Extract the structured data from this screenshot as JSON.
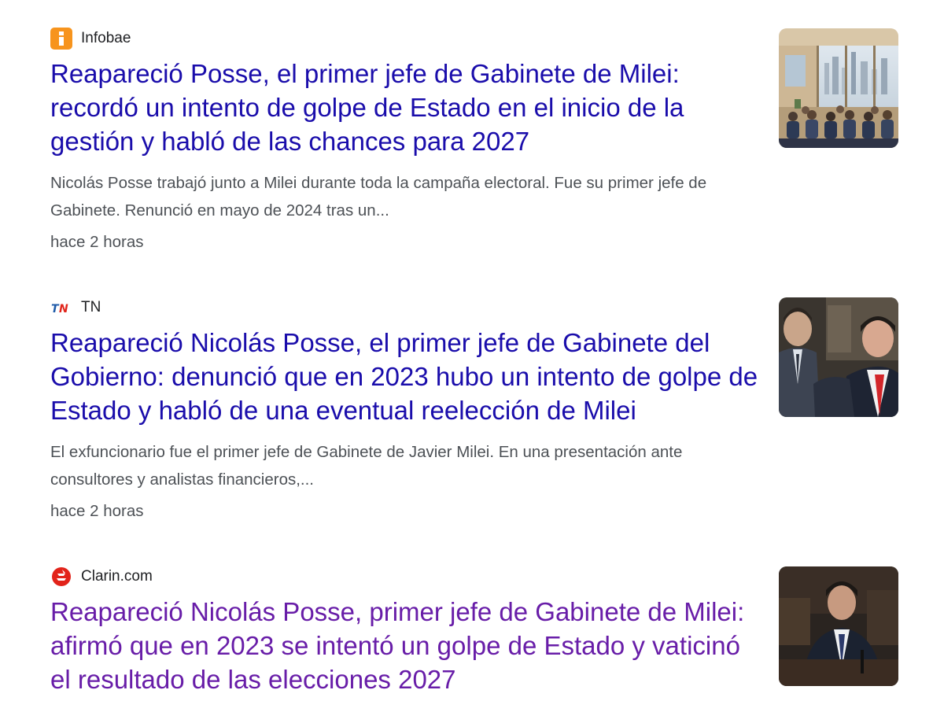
{
  "results": [
    {
      "source": "Infobae",
      "source_icon": "infobae-logo",
      "headline": "Reapareció Posse, el primer jefe de Gabinete de Milei: recordó un intento de golpe de Estado en el inicio de la gestión y habló de las chances para 2027",
      "snippet": "Nicolás Posse trabajó junto a Milei durante toda la campaña electoral. Fue su primer jefe de Gabinete. Renunció en mayo de 2024 tras un...",
      "time": "hace 2 horas",
      "thumbnail": "conference-room-illustration",
      "visited": false
    },
    {
      "source": "TN",
      "source_icon": "tn-logo",
      "headline": "Reapareció Nicolás Posse, el primer jefe de Gabinete del Gobierno: denunció que en 2023 hubo un intento de golpe de Estado y habló de una eventual reelección de Milei",
      "snippet": "El exfuncionario fue el primer jefe de Gabinete de Javier Milei. En una presentación ante consultores y analistas financieros,...",
      "time": "hace 2 horas",
      "thumbnail": "men-in-suits-photo",
      "visited": false
    },
    {
      "source": "Clarin.com",
      "source_icon": "clarin-logo",
      "headline": "Reapareció Nicolás Posse, primer jefe de Gabinete de Milei: afirmó que en 2023 se intentó un golpe de Estado y vaticinó el resultado de las elecciones 2027",
      "thumbnail": "man-at-congress-photo",
      "visited": true
    }
  ],
  "colors": {
    "link": "#1a0dab",
    "visited_link": "#681da8",
    "snippet": "#4d5156",
    "infobae_orange": "#f7941d",
    "tn_blue": "#1e5aa8",
    "tn_red": "#e1261c",
    "clarin_red": "#e2231a"
  }
}
